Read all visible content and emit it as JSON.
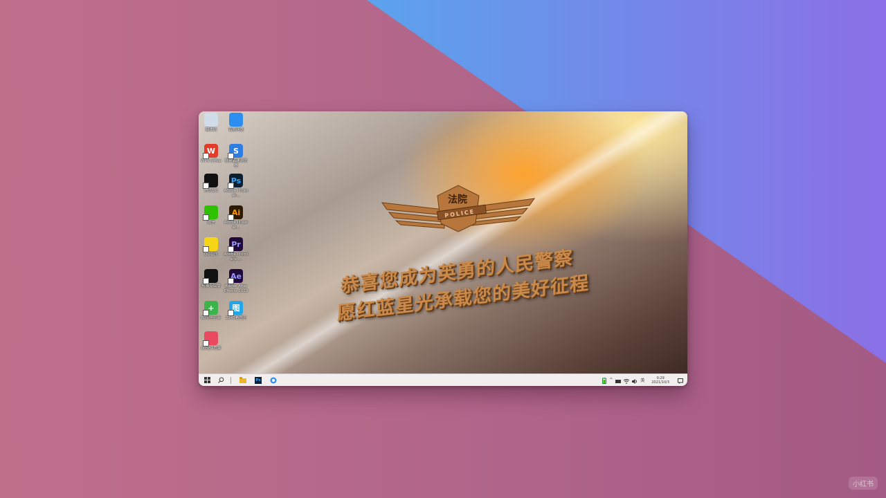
{
  "wallpaper": {
    "badge_top_text": "法院",
    "badge_band_text": "POLICE",
    "slogan_line1": "恭喜您成为英勇的人民警察",
    "slogan_line2": "愿红蓝星光承载您的美好征程"
  },
  "desktop_icons": [
    {
      "label": "回收站",
      "icon": "recycle-bin-icon",
      "color": "#d0dce8"
    },
    {
      "label": "百度网盘",
      "icon": "baidu-netdisk-icon",
      "color": "#2b8ef0"
    },
    {
      "label": "WPS Office",
      "icon": "wps-office-icon",
      "color": "#e23c2a",
      "glyph": "W"
    },
    {
      "label": "搜狗高速浏览器",
      "icon": "sogou-browser-icon",
      "color": "#2f7de1",
      "glyph": "S"
    },
    {
      "label": "腾讯QQ",
      "icon": "qq-penguin-icon",
      "color": "#111111"
    },
    {
      "label": "Adobe Photosh...",
      "icon": "photoshop-icon",
      "color": "#0c1f33",
      "glyph": "Ps",
      "fg": "#31a8ff"
    },
    {
      "label": "微信",
      "icon": "wechat-icon",
      "color": "#2dc100"
    },
    {
      "label": "Adobe Illustrat...",
      "icon": "illustrator-icon",
      "color": "#2e1a00",
      "glyph": "Ai",
      "fg": "#ff9a00"
    },
    {
      "label": "QQ音乐",
      "icon": "qq-music-icon",
      "color": "#f5d516"
    },
    {
      "label": "Adobe Premiere ...",
      "icon": "premiere-icon",
      "color": "#1f0a3a",
      "glyph": "Pr",
      "fg": "#9999ff"
    },
    {
      "label": "剪映专业版",
      "icon": "jianying-icon",
      "color": "#111111"
    },
    {
      "label": "Adobe After Effects 2019",
      "icon": "after-effects-icon",
      "color": "#1f0a3a",
      "glyph": "Ae",
      "fg": "#9999ff"
    },
    {
      "label": "60安全卫士",
      "icon": "security-guard-icon",
      "color": "#3cb44b",
      "glyph": "+"
    },
    {
      "label": "2345看图王",
      "icon": "image-viewer-icon",
      "color": "#23a6e8",
      "glyph": "图"
    },
    {
      "label": "60软件管家",
      "icon": "software-manager-icon",
      "color": "#e84a5f"
    }
  ],
  "taskbar": {
    "start_icon": "windows-start-icon",
    "search_icon": "search-icon",
    "pinned": [
      {
        "icon": "file-explorer-icon",
        "color": "#f0b429"
      },
      {
        "icon": "photoshop-taskbar-icon",
        "color": "#0c1f33",
        "glyph": "Ps"
      },
      {
        "icon": "browser-taskbar-icon",
        "color": "#2b8ef0"
      }
    ],
    "tray": {
      "battery_icon": "battery-icon",
      "input_method": "英",
      "time": "0:29",
      "date": "2021/10/3"
    }
  },
  "watermark": "小红书"
}
